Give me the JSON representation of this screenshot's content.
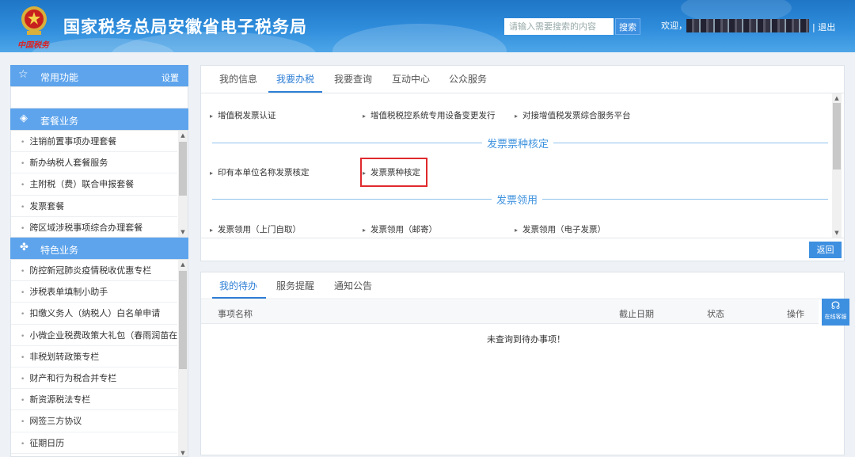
{
  "header": {
    "title": "国家税务总局安徽省电子税务局",
    "tagline": "中国税务",
    "search_placeholder": "请输入需要搜索的内容",
    "search_label": "搜索",
    "welcome": "欢迎，",
    "logout": "| 退出"
  },
  "sidebar": {
    "favorites": {
      "title": "常用功能",
      "settings": "设置"
    },
    "package": {
      "title": "套餐业务",
      "items": [
        "注销前置事项办理套餐",
        "新办纳税人套餐服务",
        "主附税（费）联合申报套餐",
        "发票套餐",
        "跨区域涉税事项综合办理套餐"
      ]
    },
    "featured": {
      "title": "特色业务",
      "items": [
        "防控新冠肺炎疫情税收优惠专栏",
        "涉税表单填制小助手",
        "扣缴义务人（纳税人）白名单申请",
        "小微企业税费政策大礼包（春雨润苗在...",
        "非税划转政策专栏",
        "财产和行为税合并专栏",
        "新资源税法专栏",
        "网签三方协议",
        "征期日历"
      ]
    }
  },
  "main_tabs": [
    "我的信息",
    "我要办税",
    "我要查询",
    "互动中心",
    "公众服务"
  ],
  "services": {
    "row1": [
      "增值税发票认证",
      "增值税税控系统专用设备变更发行",
      "对接增值税发票综合服务平台"
    ],
    "section1_title": "发票票种核定",
    "row2": [
      "印有本单位名称发票核定",
      "发票票种核定"
    ],
    "section2_title": "发票领用",
    "row3": [
      "发票领用（上门自取）",
      "发票领用（邮寄）",
      "发票领用（电子发票）"
    ],
    "back_label": "返回"
  },
  "todo": {
    "tabs": [
      "我的待办",
      "服务提醒",
      "通知公告"
    ],
    "columns": [
      "事项名称",
      "截止日期",
      "状态",
      "操作"
    ],
    "empty_text": "未查询到待办事项！",
    "support_label": "在线客服"
  },
  "colors": {
    "accent": "#2f7fd6",
    "header": "#2f8ddc",
    "highlight": "#e0292d"
  }
}
